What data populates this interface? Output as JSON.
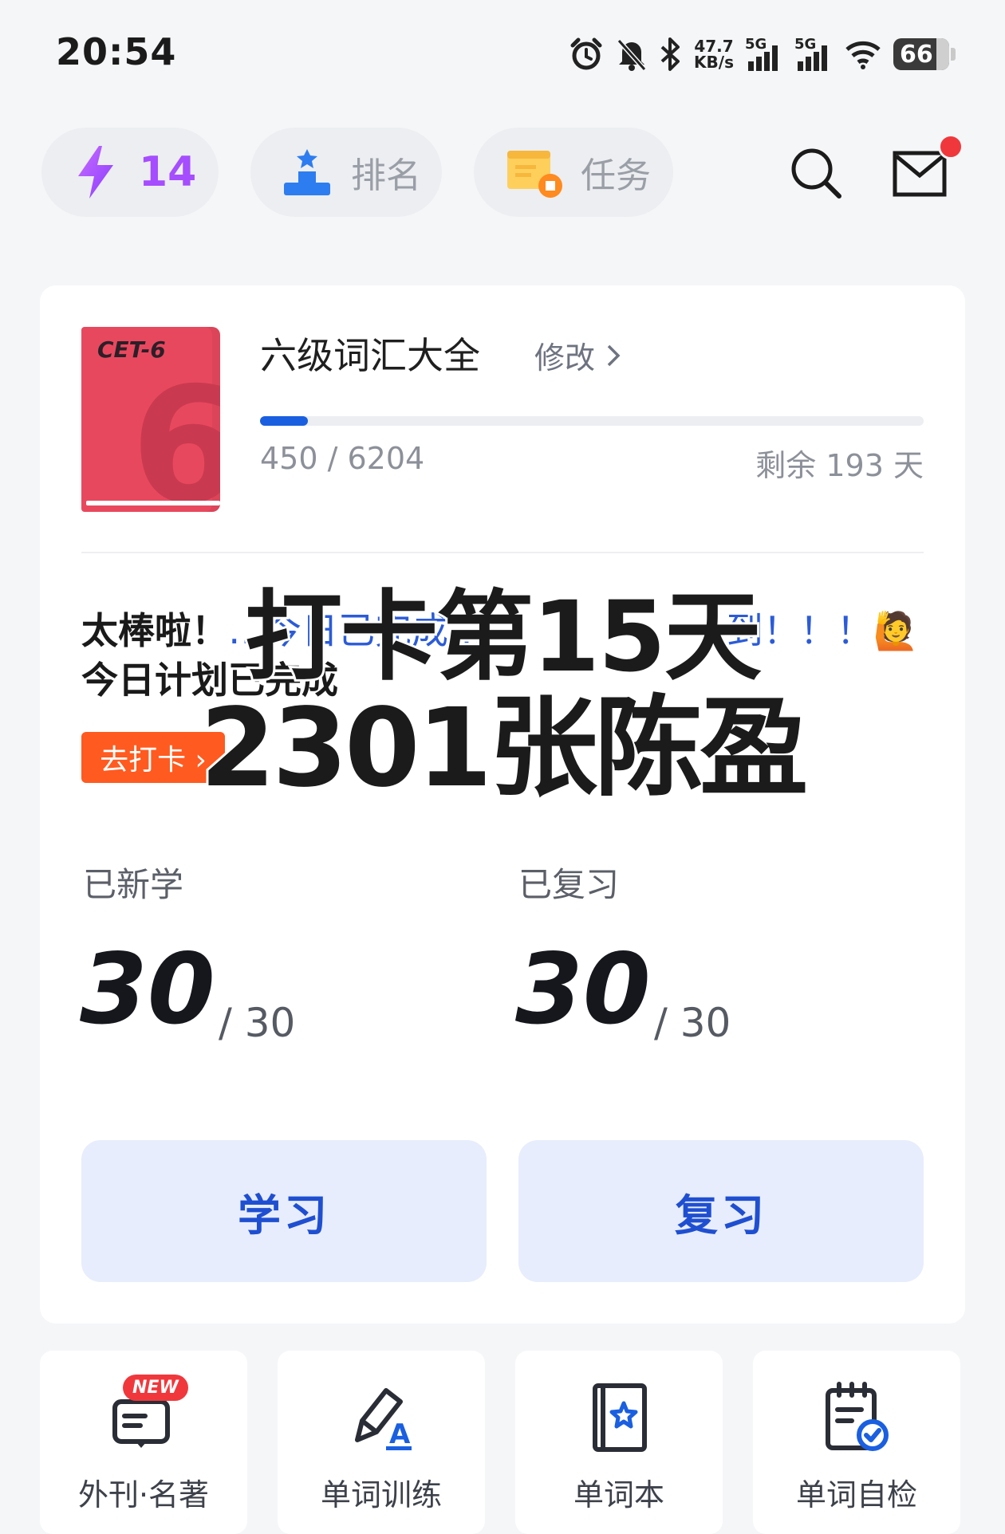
{
  "status_bar": {
    "time": "20:54",
    "net_speed_value": "47.7",
    "net_speed_unit": "KB/s",
    "signal_1": "5G",
    "signal_2": "5G",
    "battery": "66"
  },
  "top_bar": {
    "streak_count": "14",
    "rank_label": "排名",
    "task_label": "任务"
  },
  "book": {
    "cover_series": "CET-6",
    "cover_number": "6",
    "title": "六级词汇大全",
    "edit_label": "修改",
    "progress_learned": 450,
    "progress_total": 6204,
    "progress_text": "450 / 6204",
    "remaining_text": "剩余 193 天"
  },
  "checkin": {
    "congrats_line1_a": "太棒啦！",
    "congrats_line1_b": "…今日已完成…",
    "congrats_line1_c": "到！！！🙋",
    "congrats_line2": "今日计划已完成",
    "button_label": "去打卡 ›"
  },
  "overlay_text": {
    "line1": "打卡第15天",
    "line2": "2301张陈盈"
  },
  "stats": {
    "new_label": "已新学",
    "new_done": "30",
    "new_total": "/ 30",
    "review_label": "已复习",
    "review_done": "30",
    "review_total": "/ 30"
  },
  "actions": {
    "study_label": "学习",
    "review_label": "复习"
  },
  "tiles": [
    {
      "label": "外刊·名著",
      "badge": "NEW",
      "icon": "book-news-icon"
    },
    {
      "label": "单词训练",
      "icon": "pen-a-icon"
    },
    {
      "label": "单词本",
      "icon": "star-notebook-icon"
    },
    {
      "label": "单词自检",
      "icon": "calendar-check-icon"
    }
  ],
  "colors": {
    "accent_blue": "#1a5fe0",
    "streak_purple": "#a64dff",
    "checkin_orange": "#ff5a1f",
    "book_red": "#e8485e",
    "notification_red": "#f0383c"
  }
}
